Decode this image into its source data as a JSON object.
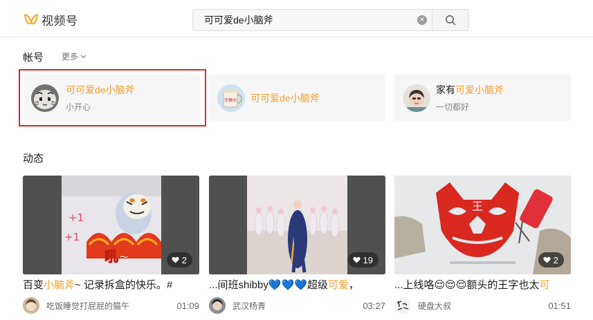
{
  "app": {
    "name": "视频号"
  },
  "search": {
    "value": "可可爱de小脑斧",
    "clear_glyph": "×"
  },
  "accounts_section": {
    "title": "帐号",
    "more_label": "更多",
    "items": [
      {
        "name_prefix": "",
        "name_highlight": "可可爱de小脑斧",
        "desc": "小开心",
        "avatar_icon": "tiger-face-avatar",
        "selected": true
      },
      {
        "name_prefix": "",
        "name_highlight": "可可爱de小脑斧",
        "desc": "",
        "avatar_icon": "mug-avatar",
        "avatar_text": "多糖水",
        "selected": false
      },
      {
        "name_prefix": "家有",
        "name_highlight": "可爱小脑斧",
        "desc": "一切都好",
        "avatar_icon": "person-avatar",
        "selected": false
      }
    ]
  },
  "feed_section": {
    "title": "动态",
    "items": [
      {
        "title_parts": [
          "百变",
          "小脑斧",
          "~ 记录拆盒的快乐。#"
        ],
        "likes": "2",
        "author": "吃饭睡觉打屁屁的猫午",
        "duration": "01:09",
        "thumb_text": [
          "+1",
          "+1",
          "吼~"
        ]
      },
      {
        "title_parts": [
          "...间班shibby💙💙💙超级",
          "可爱",
          "，"
        ],
        "likes": "19",
        "author": "武汉杨青",
        "duration": "03:27"
      },
      {
        "title_parts": [
          "...上线咯😌😌😌额头的王字也太",
          "可",
          ""
        ],
        "likes": "2",
        "author": "硬盘大叔",
        "duration": "01:51",
        "thumb_text": [
          "王"
        ]
      }
    ]
  },
  "colors": {
    "highlight": "#f0a030",
    "selection_border": "#d9262c",
    "logo": "#f5a623"
  }
}
